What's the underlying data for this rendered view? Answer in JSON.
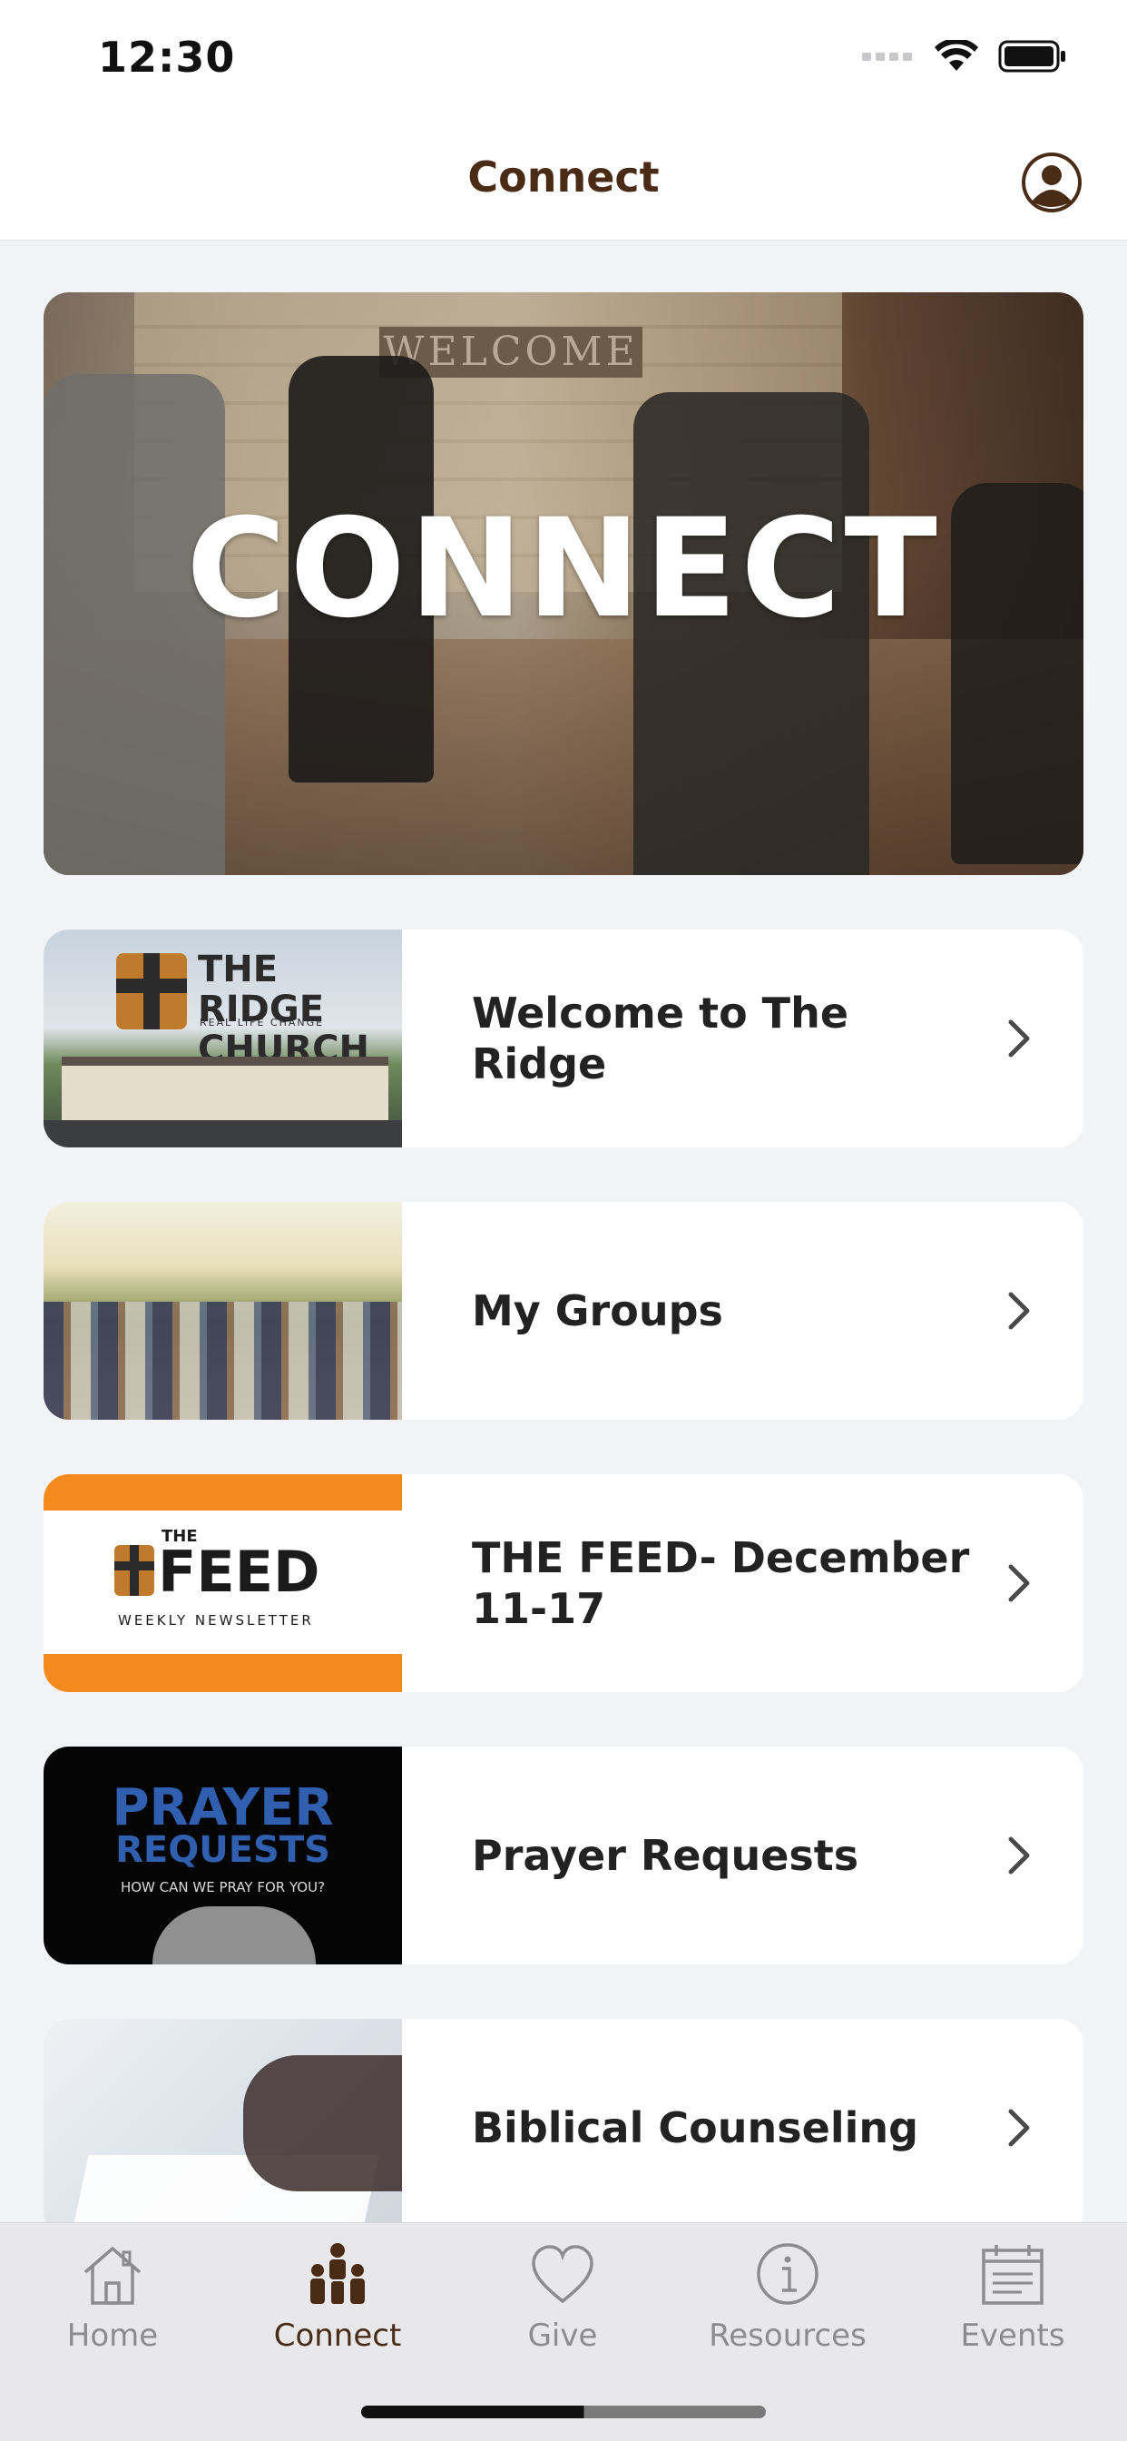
{
  "status_bar": {
    "time": "12:30"
  },
  "nav": {
    "title": "Connect"
  },
  "hero": {
    "title": "CONNECT",
    "sign_text": "WELCOME"
  },
  "items": [
    {
      "label": "Welcome to The Ridge",
      "thumb_text": "THE RIDGE CHURCH",
      "thumb_sub": "REAL LIFE CHANGE"
    },
    {
      "label": "My Groups"
    },
    {
      "label": "THE FEED- December 11-17",
      "thumb_text": "FEED",
      "thumb_small": "THE",
      "thumb_sub": "WEEKLY NEWSLETTER"
    },
    {
      "label": "Prayer Requests",
      "thumb_text1": "PRAYER",
      "thumb_text2": "REQUESTS",
      "thumb_sub": "HOW CAN WE PRAY FOR YOU?"
    },
    {
      "label": "Biblical Counseling"
    }
  ],
  "tabs": [
    {
      "label": "Home",
      "icon": "home-icon",
      "active": false
    },
    {
      "label": "Connect",
      "icon": "people-icon",
      "active": true
    },
    {
      "label": "Give",
      "icon": "heart-icon",
      "active": false
    },
    {
      "label": "Resources",
      "icon": "info-icon",
      "active": false
    },
    {
      "label": "Events",
      "icon": "calendar-icon",
      "active": false
    }
  ],
  "colors": {
    "accent": "#4a2c16",
    "inactive": "#8c8c90",
    "background": "#f2f3f7"
  }
}
